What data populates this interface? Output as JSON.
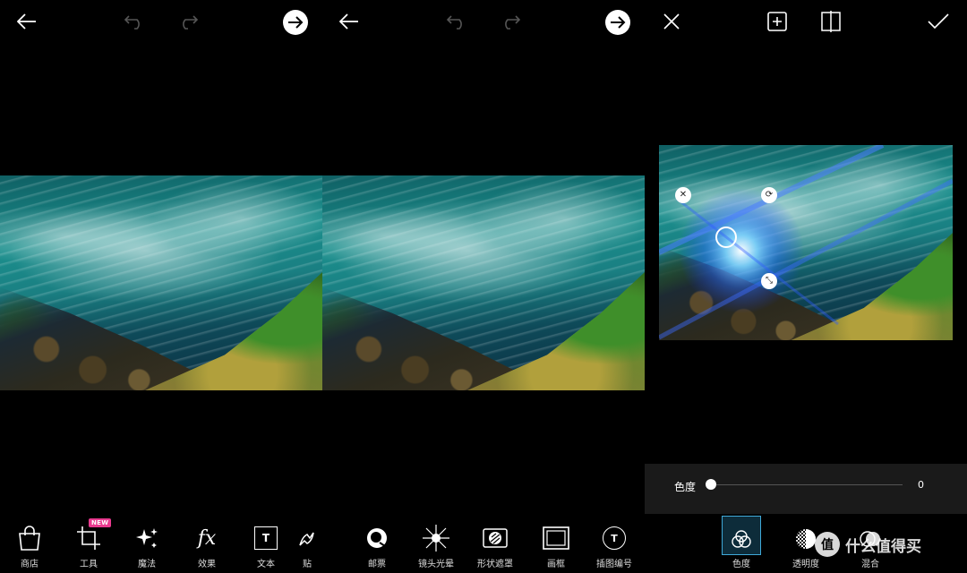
{
  "panel1": {
    "toolbar": [
      {
        "label": "商店",
        "icon": "bag-icon"
      },
      {
        "label": "工具",
        "icon": "crop-icon",
        "badge": "NEW"
      },
      {
        "label": "魔法",
        "icon": "sparkle-icon"
      },
      {
        "label": "效果",
        "icon": "fx-icon"
      },
      {
        "label": "文本",
        "icon": "text-icon"
      },
      {
        "label": "贴",
        "icon": "sticker-icon"
      }
    ],
    "fx_glyph": "fx",
    "text_glyph": "T"
  },
  "panel2": {
    "toolbar": [
      {
        "label": "邮票",
        "icon": "stamp-icon"
      },
      {
        "label": "镜头光晕",
        "icon": "lens-flare-icon"
      },
      {
        "label": "形状遮罩",
        "icon": "shape-mask-icon"
      },
      {
        "label": "画框",
        "icon": "frame-icon"
      },
      {
        "label": "插图编号",
        "icon": "callout-icon"
      }
    ],
    "callout_glyph": "T"
  },
  "panel3": {
    "slider": {
      "label": "色度",
      "value": "0"
    },
    "blend_tools": [
      {
        "label": "色度",
        "icon": "hue-icon",
        "active": true
      },
      {
        "label": "透明度",
        "icon": "opacity-icon",
        "active": false
      },
      {
        "label": "混合",
        "icon": "blend-icon",
        "active": false
      }
    ],
    "handles": {
      "close": "✕",
      "rotate": "⟳",
      "resize": "⤡"
    }
  },
  "watermark": "值 什么值得买",
  "colors": {
    "accent": "#3fa9d8",
    "badge": "#e93a8f",
    "background": "#000000"
  }
}
